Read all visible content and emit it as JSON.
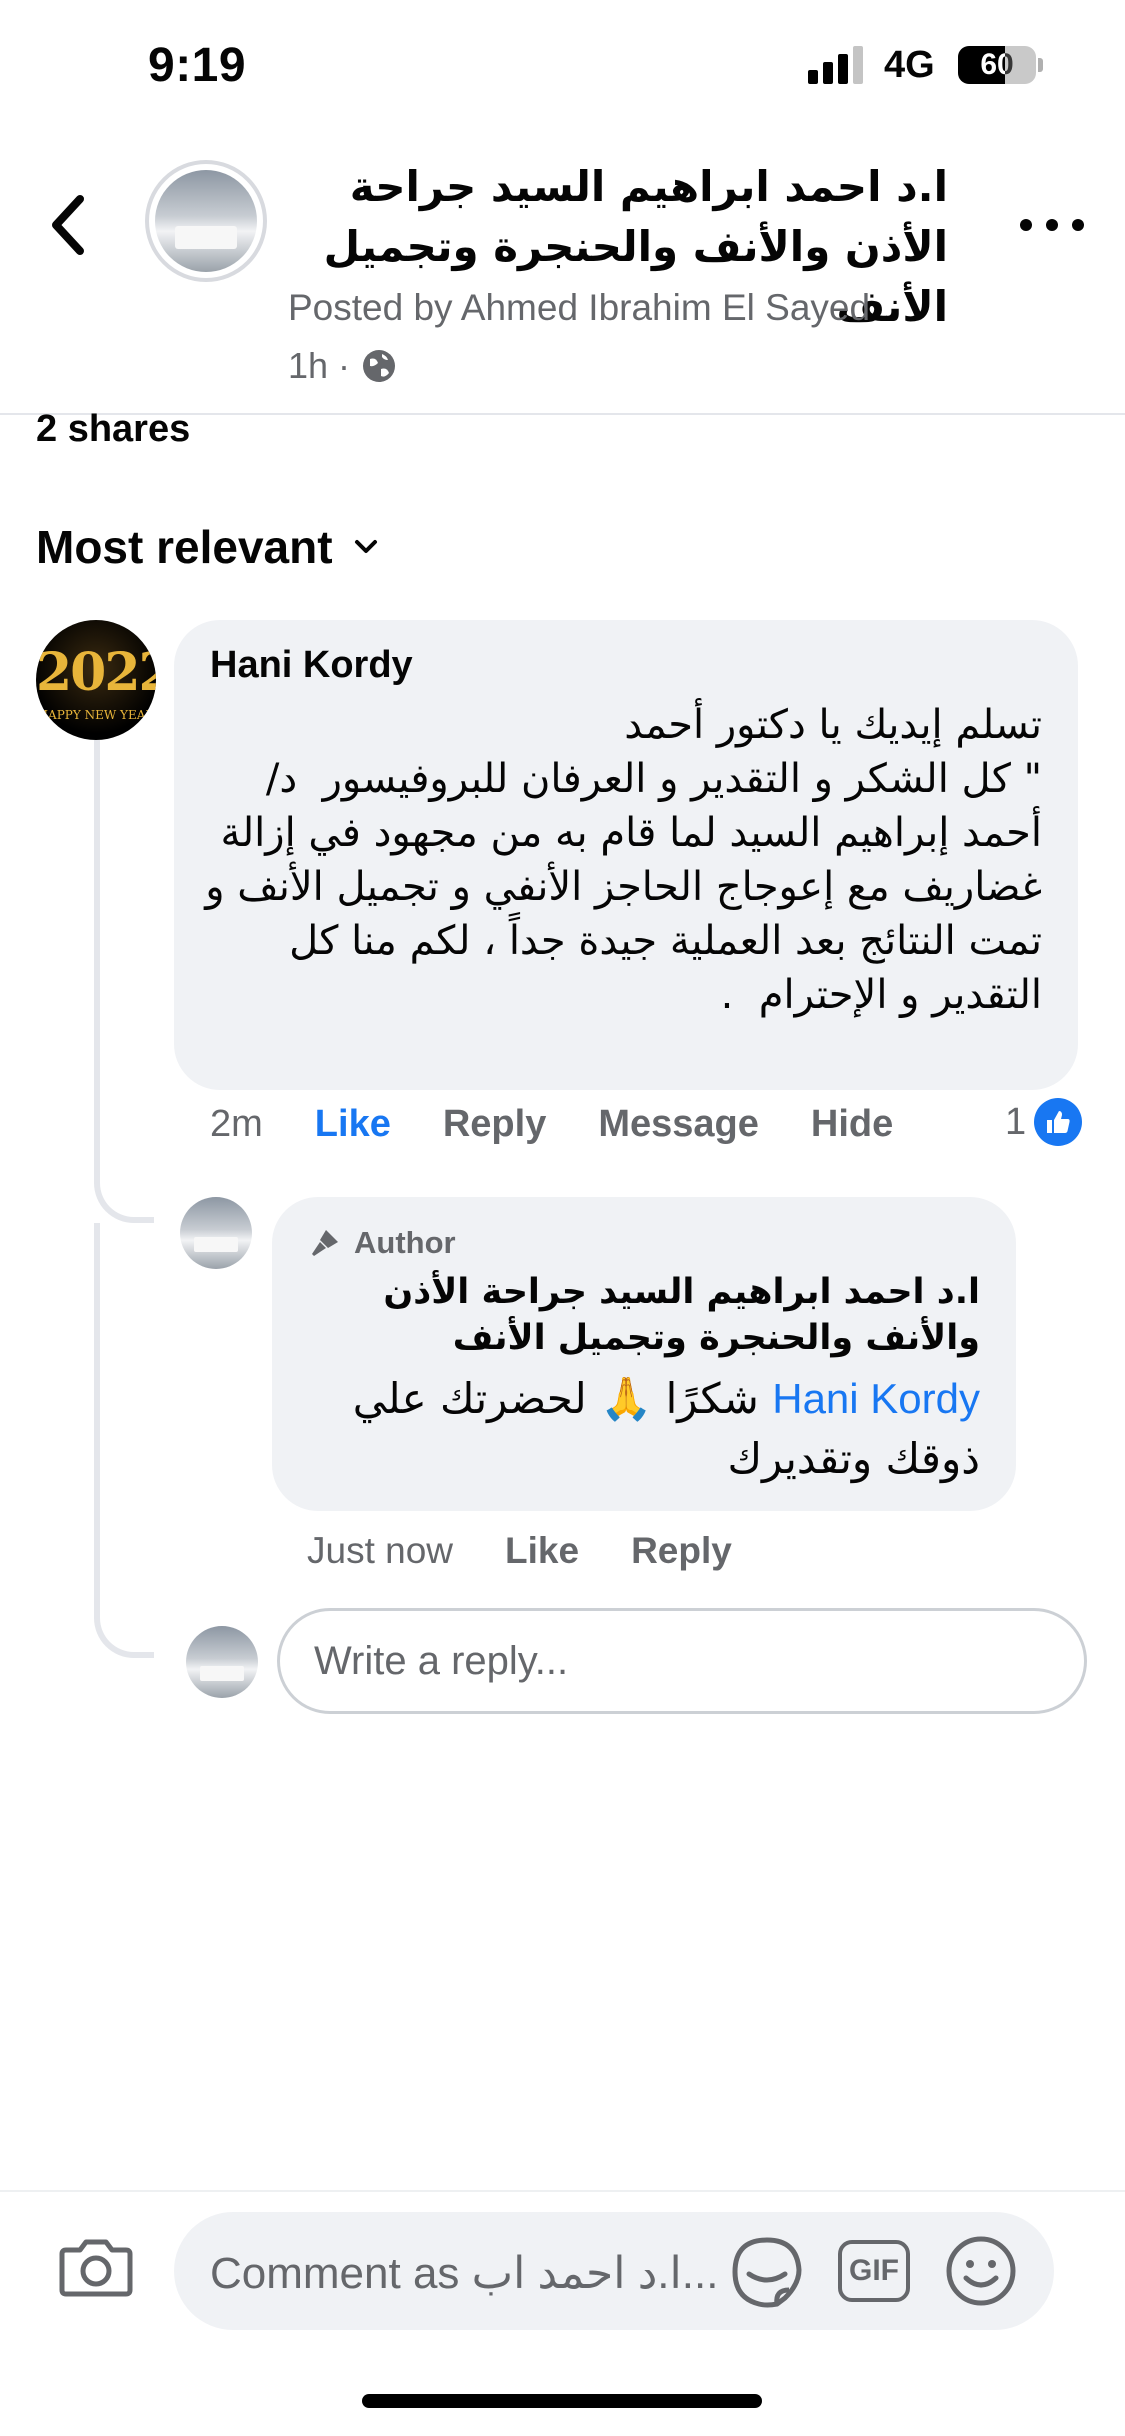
{
  "status_bar": {
    "time": "9:19",
    "network": "4G",
    "battery": "60"
  },
  "header": {
    "title": "ا.د احمد ابراهيم السيد جراحة الأذن والأنف والحنجرة وتجميل الأنف",
    "posted_by": "Posted by Ahmed Ibrahim El Sayed",
    "time": "1h",
    "separator": "·"
  },
  "post": {
    "shares": "2 shares",
    "sort_label": "Most relevant"
  },
  "comment": {
    "author": "Hani Kordy",
    "text": "تسلم إيديك يا دكتور أحمد\n\" كل الشكر و التقدير و العرفان للبروفيسور  د/ أحمد إبراهيم السيد لما قام به من مجهود في إزالة غضاريف مع إعوجاج الحاجز الأنفي و تجميل الأنف و تمت النتائج بعد العملية جيدة جداً ، لكم منا كل التقدير و الإحترام  .",
    "time": "2m",
    "like_label": "Like",
    "reply_label": "Reply",
    "message_label": "Message",
    "hide_label": "Hide",
    "reaction_count": "1",
    "avatar_text": "2022",
    "avatar_subtext": "HAPPY NEW YEAR"
  },
  "reply": {
    "badge": "Author",
    "author": "ا.د احمد ابراهيم السيد جراحة الأذن والأنف والحنجرة وتجميل الأنف",
    "mention": "Hani Kordy",
    "text": " شكرًا 🙏 لحضرتك علي ذوقك وتقديرك",
    "time": "Just now",
    "like_label": "Like",
    "reply_label": "Reply"
  },
  "reply_input": {
    "placeholder": "Write a reply..."
  },
  "composer": {
    "placeholder": "Comment as ا.د احمد اب...",
    "gif_label": "GIF"
  },
  "colors": {
    "accent": "#1877f2",
    "secondary_text": "#65676b",
    "bubble": "#f0f2f5"
  }
}
